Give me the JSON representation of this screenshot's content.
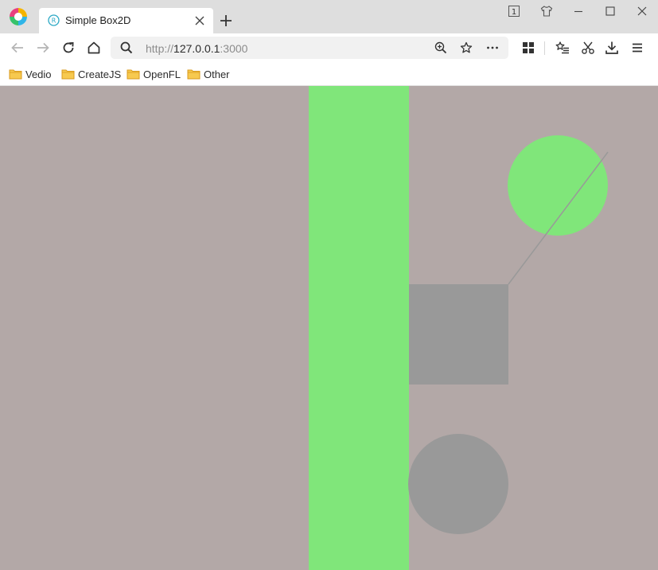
{
  "tab": {
    "title": "Simple Box2D"
  },
  "address_bar": {
    "protocol": "http://",
    "host": "127.0.0.1",
    "port": ":3000"
  },
  "bookmarks": [
    {
      "label": "Vedio"
    },
    {
      "label": "CreateJS"
    },
    {
      "label": "OpenFL"
    },
    {
      "label": "Other"
    }
  ],
  "window": {
    "tab_count": "1"
  },
  "colors": {
    "canvas_background": "#b3a8a7",
    "awake_body": "#80e67a",
    "sleeping_body": "#999999",
    "joint_line": "#999999",
    "bookmark_folder": "#f5b93a",
    "accent": "#2aa8c4"
  }
}
